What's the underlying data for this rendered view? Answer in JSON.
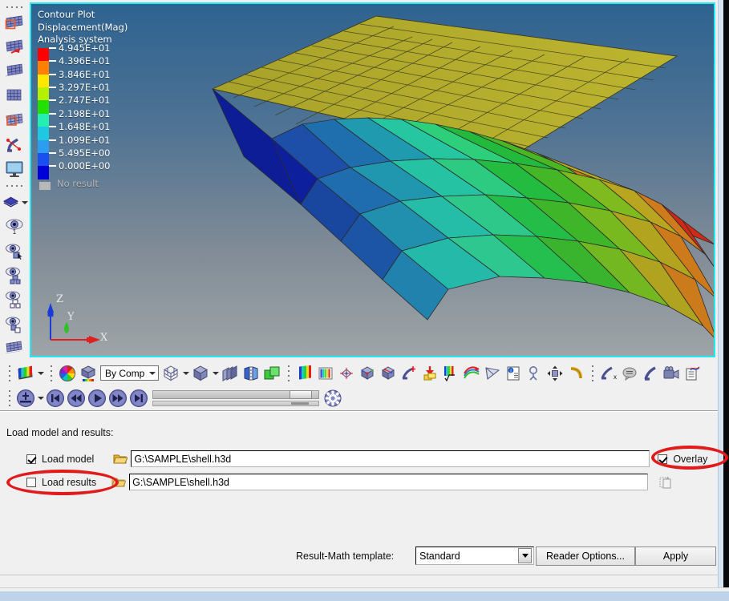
{
  "viewport": {
    "legend_title": [
      "Contour Plot",
      "Displacement(Mag)",
      "Analysis system"
    ],
    "legend_entries": [
      {
        "value": "4.945E+01",
        "color": "#ff0000"
      },
      {
        "value": "4.396E+01",
        "color": "#ff8000"
      },
      {
        "value": "3.846E+01",
        "color": "#ffe800"
      },
      {
        "value": "3.297E+01",
        "color": "#b5f000"
      },
      {
        "value": "2.747E+01",
        "color": "#22e000"
      },
      {
        "value": "2.198E+01",
        "color": "#24eeb0"
      },
      {
        "value": "1.648E+01",
        "color": "#1ec8e0"
      },
      {
        "value": "1.099E+01",
        "color": "#2b9ef0"
      },
      {
        "value": "5.495E+00",
        "color": "#1a4ff0"
      },
      {
        "value": "0.000E+00",
        "color": "#0000d8"
      }
    ],
    "no_result_label": "No result",
    "axis_labels": {
      "x": "X",
      "y": "Y",
      "z": "Z"
    },
    "background_top": "#2e6390",
    "background_bottom": "#9ea4a7",
    "border_color": "#24e8f0"
  },
  "left_toolbar": {
    "items": [
      {
        "name": "contour-plot-icon"
      },
      {
        "name": "vector-plot-icon"
      },
      {
        "name": "iso-value-icon"
      },
      {
        "name": "deformed-shape-icon"
      },
      {
        "name": "tensor-plot-icon"
      },
      {
        "name": "streamlines-icon"
      },
      {
        "name": "display-icon"
      },
      {
        "name": "layers-icon"
      },
      {
        "name": "visibility-all-icon"
      },
      {
        "name": "visibility-pick-icon"
      },
      {
        "name": "visibility-expand-icon"
      },
      {
        "name": "visibility-collapse-icon"
      },
      {
        "name": "visibility-swap-icon"
      },
      {
        "name": "mesh-icon"
      }
    ]
  },
  "toolbar_row1": {
    "items": [
      {
        "name": "contour-toolbar-icon",
        "has_caret": true
      },
      {
        "name": "color-wheel-icon",
        "has_caret": false
      },
      {
        "name": "legend-cube-icon",
        "has_caret": false
      }
    ],
    "by_comp_label": "By Comp",
    "items2": [
      {
        "name": "mesh-cube-icon",
        "has_caret": true
      },
      {
        "name": "solid-cube-icon",
        "has_caret": true
      },
      {
        "name": "layers-stack-icon",
        "has_caret": false
      },
      {
        "name": "mirror-icon",
        "has_caret": false
      },
      {
        "name": "overlay-green-icon",
        "has_caret": false
      }
    ],
    "items3": [
      {
        "name": "color-bar-icon"
      },
      {
        "name": "legend-bars-icon"
      },
      {
        "name": "node-diamond-icon"
      },
      {
        "name": "cube-axes-icon"
      },
      {
        "name": "cube-nodes-icon"
      },
      {
        "name": "curve-plus-icon"
      },
      {
        "name": "load-arrow-icon"
      },
      {
        "name": "math-sqrt-icon"
      },
      {
        "name": "streamline-multi-icon"
      },
      {
        "name": "antenna-icon"
      },
      {
        "name": "info-table-icon"
      },
      {
        "name": "measure-icon"
      },
      {
        "name": "move-icon"
      },
      {
        "name": "angle-icon"
      }
    ],
    "items4": [
      {
        "name": "curve-x-icon"
      },
      {
        "name": "note-icon"
      },
      {
        "name": "curve-icon"
      },
      {
        "name": "camera-icon"
      },
      {
        "name": "report-icon"
      }
    ]
  },
  "toolbar_row2": {
    "items": [
      {
        "name": "animation-mode-icon",
        "has_caret": true
      },
      {
        "name": "first-frame-icon",
        "has_caret": false
      },
      {
        "name": "rewind-icon",
        "has_caret": false
      },
      {
        "name": "play-icon",
        "has_caret": false
      },
      {
        "name": "fast-forward-icon",
        "has_caret": false
      },
      {
        "name": "last-frame-icon",
        "has_caret": false
      }
    ],
    "settings_icon": "gear-icon"
  },
  "panel": {
    "section_label": "Load model and results:",
    "rows": [
      {
        "checkbox_label": "Load model",
        "checked": true,
        "path": "G:\\SAMPLE\\shell.h3d",
        "folder_icon": "folder-open-icon"
      },
      {
        "checkbox_label": "Load results",
        "checked": false,
        "path": "G:\\SAMPLE\\shell.h3d",
        "folder_icon": "folder-open-icon"
      }
    ],
    "overlay": {
      "label": "Overlay",
      "checked": true
    },
    "copy_icon": "copy-paste-icon",
    "result_math_label": "Result-Math template:",
    "result_math_value": "Standard",
    "reader_options_label": "Reader Options...",
    "apply_label": "Apply",
    "annotation_color": "#e01b1b"
  }
}
